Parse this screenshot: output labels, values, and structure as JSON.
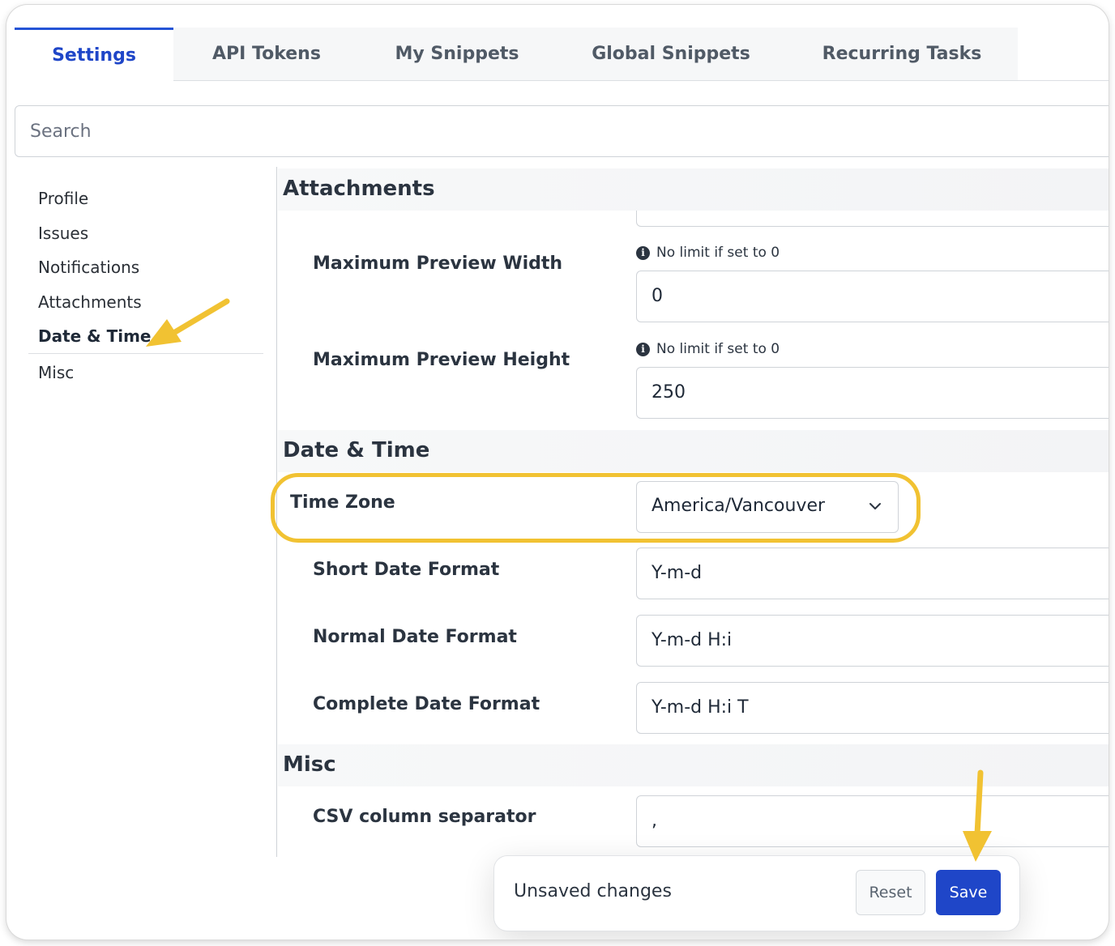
{
  "tabs": [
    {
      "label": "Settings",
      "active": true
    },
    {
      "label": "API Tokens",
      "active": false
    },
    {
      "label": "My Snippets",
      "active": false
    },
    {
      "label": "Global Snippets",
      "active": false
    },
    {
      "label": "Recurring Tasks",
      "active": false
    }
  ],
  "search": {
    "placeholder": "Search"
  },
  "sidebar": {
    "items": [
      {
        "label": "Profile"
      },
      {
        "label": "Issues"
      },
      {
        "label": "Notifications"
      },
      {
        "label": "Attachments"
      },
      {
        "label": "Date & Time",
        "active": true
      },
      {
        "label": "Misc"
      }
    ]
  },
  "attachments": {
    "title": "Attachments",
    "max_width": {
      "label": "Maximum Preview Width",
      "hint": "No limit if set to 0",
      "value": "0"
    },
    "max_height": {
      "label": "Maximum Preview Height",
      "hint": "No limit if set to 0",
      "value": "250"
    }
  },
  "datetime": {
    "title": "Date & Time",
    "timezone": {
      "label": "Time Zone",
      "value": "America/Vancouver"
    },
    "short_format": {
      "label": "Short Date Format",
      "value": "Y-m-d"
    },
    "normal_format": {
      "label": "Normal Date Format",
      "value": "Y-m-d H:i"
    },
    "complete_format": {
      "label": "Complete Date Format",
      "value": "Y-m-d H:i T"
    }
  },
  "misc": {
    "title": "Misc",
    "csv_separator": {
      "label": "CSV column separator",
      "value": ","
    }
  },
  "toast": {
    "text": "Unsaved changes",
    "reset_label": "Reset",
    "save_label": "Save"
  },
  "colors": {
    "accent": "#1f46c8",
    "annotation": "#f1c232"
  },
  "icons": {
    "info": "info-icon",
    "chevron": "chevron-down-icon",
    "arrow": "annotation-arrow"
  }
}
